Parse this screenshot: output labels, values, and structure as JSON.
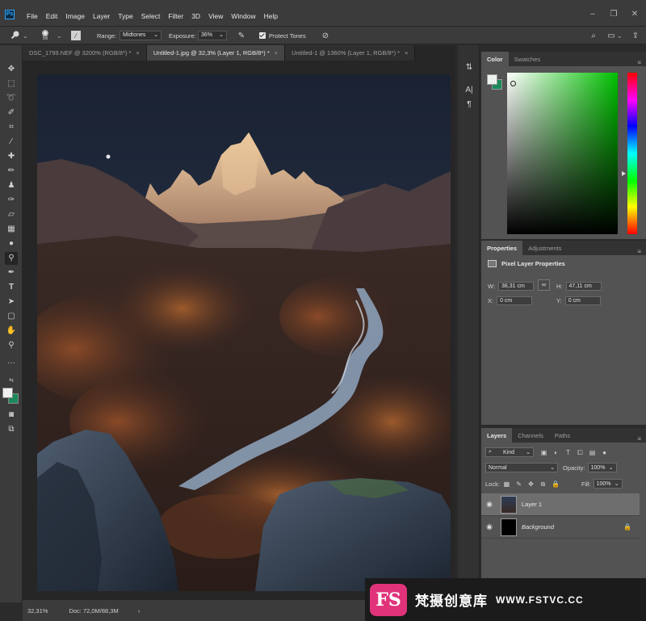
{
  "app": {
    "logo_text": "Ps"
  },
  "menu": [
    "File",
    "Edit",
    "Image",
    "Layer",
    "Type",
    "Select",
    "Filter",
    "3D",
    "View",
    "Window",
    "Help"
  ],
  "options": {
    "brush_size": "56",
    "range_label": "Range:",
    "range_value": "Midtones",
    "exposure_label": "Exposure:",
    "exposure_value": "36%",
    "protect_tones_label": "Protect Tones",
    "protect_tones_checked": true
  },
  "tabs": [
    {
      "label": "DSC_1799.NEF @ 3200% (RGB/8*) *",
      "active": false
    },
    {
      "label": "Untitled-1.jpg @ 32,3% (Layer 1, RGB/8*) *",
      "active": true
    },
    {
      "label": "Untitled-1 @ 1360% (Layer 1, RGB/8*) *",
      "active": false
    }
  ],
  "tab_close": "×",
  "status": {
    "zoom": "32,31%",
    "doc": "Doc: 72,0M/88,3M",
    "arrow": "›"
  },
  "color_panel": {
    "tabs": [
      "Color",
      "Swatches"
    ],
    "fg_color": "#eef2ee",
    "bg_color": "#1c8a5a"
  },
  "properties": {
    "tabs": [
      "Properties",
      "Adjustments"
    ],
    "title": "Pixel Layer Properties",
    "w_label": "W:",
    "w_value": "38,31 cm",
    "h_label": "H:",
    "h_value": "47,11 cm",
    "x_label": "X:",
    "x_value": "0 cm",
    "y_label": "Y:",
    "y_value": "0 cm"
  },
  "layers": {
    "tabs": [
      "Layers",
      "Channels",
      "Paths"
    ],
    "filter_kind": "Kind",
    "blend_mode": "Normal",
    "opacity_label": "Opacity:",
    "opacity_value": "100%",
    "lock_label": "Lock:",
    "fill_label": "Fill:",
    "fill_value": "100%",
    "items": [
      {
        "name": "Layer 1",
        "selected": true
      },
      {
        "name": "Background",
        "selected": false
      }
    ]
  },
  "watermark": {
    "logo": "FS",
    "title": "梵摄创意库",
    "url": "WWW.FSTVC.CC"
  }
}
